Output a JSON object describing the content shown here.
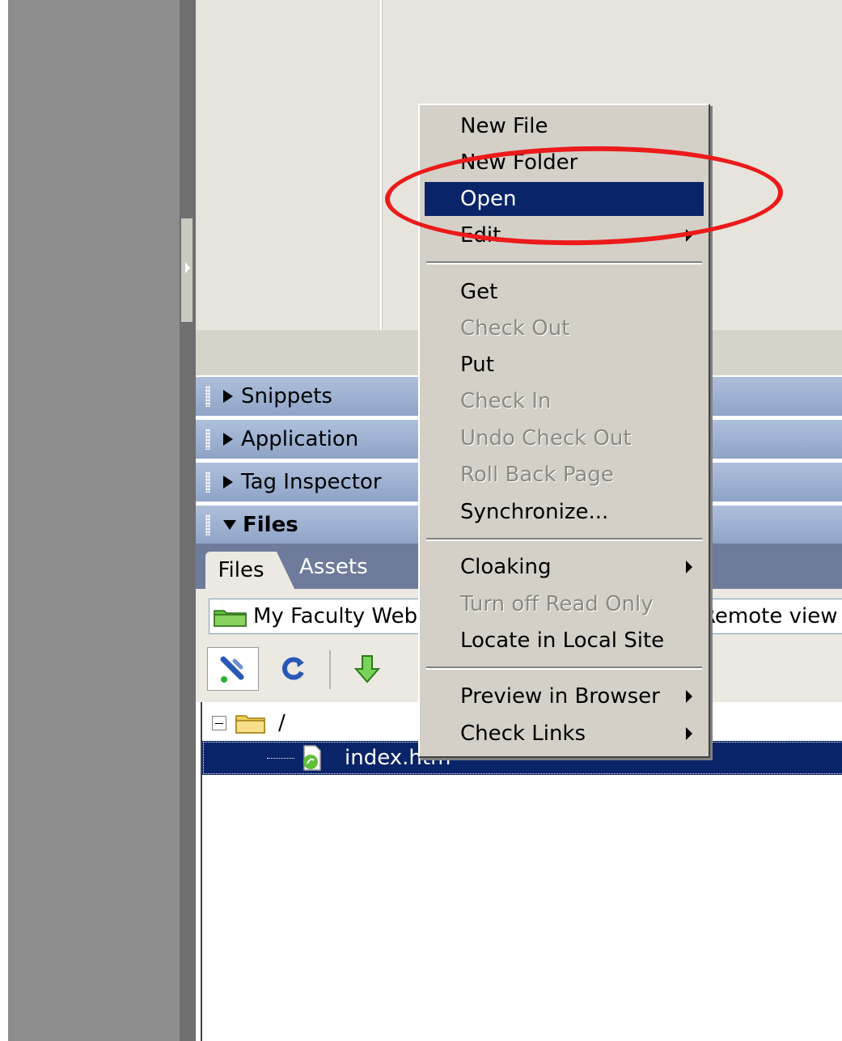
{
  "panels": {
    "snippets": "Snippets",
    "application": "Application",
    "tag_inspector": "Tag Inspector",
    "files": "Files"
  },
  "files_panel": {
    "tabs": [
      "Files",
      "Assets"
    ],
    "site_select": "My Faculty Web",
    "view_select": "Remote view",
    "tree": {
      "root_label": "/",
      "selected_file": "index.htm"
    }
  },
  "context_menu": {
    "items": [
      {
        "label": "New File",
        "enabled": true
      },
      {
        "label": "New Folder",
        "enabled": true
      },
      {
        "label": "Open",
        "enabled": true,
        "highlighted": true
      },
      {
        "label": "Edit",
        "enabled": true,
        "submenu": true
      },
      {
        "label": "Get",
        "enabled": true
      },
      {
        "label": "Check Out",
        "enabled": false
      },
      {
        "label": "Put",
        "enabled": true
      },
      {
        "label": "Check In",
        "enabled": false
      },
      {
        "label": "Undo Check Out",
        "enabled": false
      },
      {
        "label": "Roll Back Page",
        "enabled": false
      },
      {
        "label": "Synchronize...",
        "enabled": true
      },
      {
        "label": "Cloaking",
        "enabled": true,
        "submenu": true
      },
      {
        "label": "Turn off Read Only",
        "enabled": false
      },
      {
        "label": "Locate in Local Site",
        "enabled": true
      },
      {
        "label": "Preview in Browser",
        "enabled": true,
        "submenu": true
      },
      {
        "label": "Check Links",
        "enabled": true,
        "submenu": true
      }
    ]
  },
  "colors": {
    "highlight": "#0a246a",
    "annotation": "#ec1a1a",
    "menu_bg": "#d4d0c8",
    "panel_header": "#9aaed0"
  },
  "icons": [
    "folder-icon",
    "connect-icon",
    "refresh-icon",
    "get-arrow-icon",
    "file-htm-icon",
    "expander-minus-icon",
    "submenu-arrow-icon"
  ]
}
